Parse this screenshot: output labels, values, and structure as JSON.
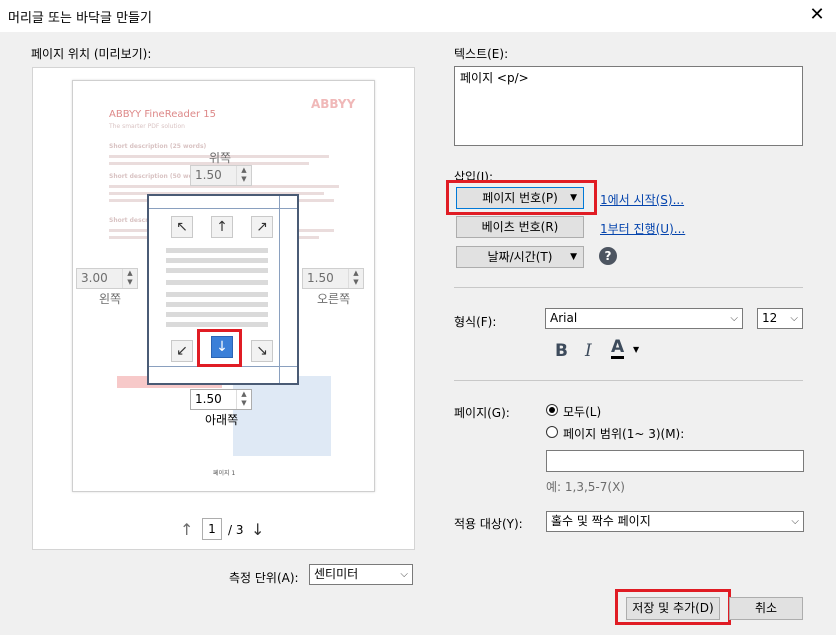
{
  "window": {
    "title": "머리글 또는 바닥글 만들기",
    "close_glyph": "✕"
  },
  "preview": {
    "label": "페이지 위치 (미리보기):",
    "doc": {
      "title": "ABBYY FineReader 15",
      "subtitle": "The smarter PDF solution",
      "logo": "ABBYY",
      "heading1": "Short description (25 words)",
      "heading2": "Short description (50 words)",
      "heading3": "Short description",
      "page_label": "페이지 1"
    },
    "margins": {
      "top_label": "위쪽",
      "top_value": "1.50",
      "left_label": "왼쪽",
      "left_value": "3.00",
      "right_label": "오른쪽",
      "right_value": "1.50",
      "bottom_label": "아래쪽",
      "bottom_value": "1.50"
    },
    "pager": {
      "current": "1",
      "total": "/ 3"
    },
    "arrows": {
      "nw": "↖",
      "n": "↑",
      "ne": "↗",
      "sw": "↙",
      "s": "↓",
      "se": "↘"
    }
  },
  "units": {
    "label": "측정 단위(A):",
    "value": "센티미터"
  },
  "text": {
    "label": "텍스트(E):",
    "value": "페이지 <p/>"
  },
  "insert": {
    "label": "삽입(I):",
    "page_number_btn": "페이지 번호(P)",
    "bates_btn": "베이츠 번호(R)",
    "datetime_btn": "날짜/시간(T)",
    "start_link": "1에서 시작(S)...",
    "increment_link": "1부터 진행(U)...",
    "help_glyph": "?"
  },
  "format": {
    "label": "형식(F):",
    "font": "Arial",
    "size": "12",
    "bold": "B",
    "italic": "I",
    "color_glyph": "A"
  },
  "pages": {
    "label": "페이지(G):",
    "all": "모두(L)",
    "range": "페이지 범위(1~ 3)(M):",
    "range_value": "",
    "example": "예: 1,3,5-7(X)"
  },
  "apply_to": {
    "label": "적용 대상(Y):",
    "value": "홀수 및 짝수 페이지"
  },
  "footer": {
    "save_btn": "저장 및 추가(D)",
    "cancel_btn": "취소"
  },
  "colors": {
    "highlight": "#e01c24",
    "accent": "#3b7fd8",
    "link": "#0645ad"
  }
}
